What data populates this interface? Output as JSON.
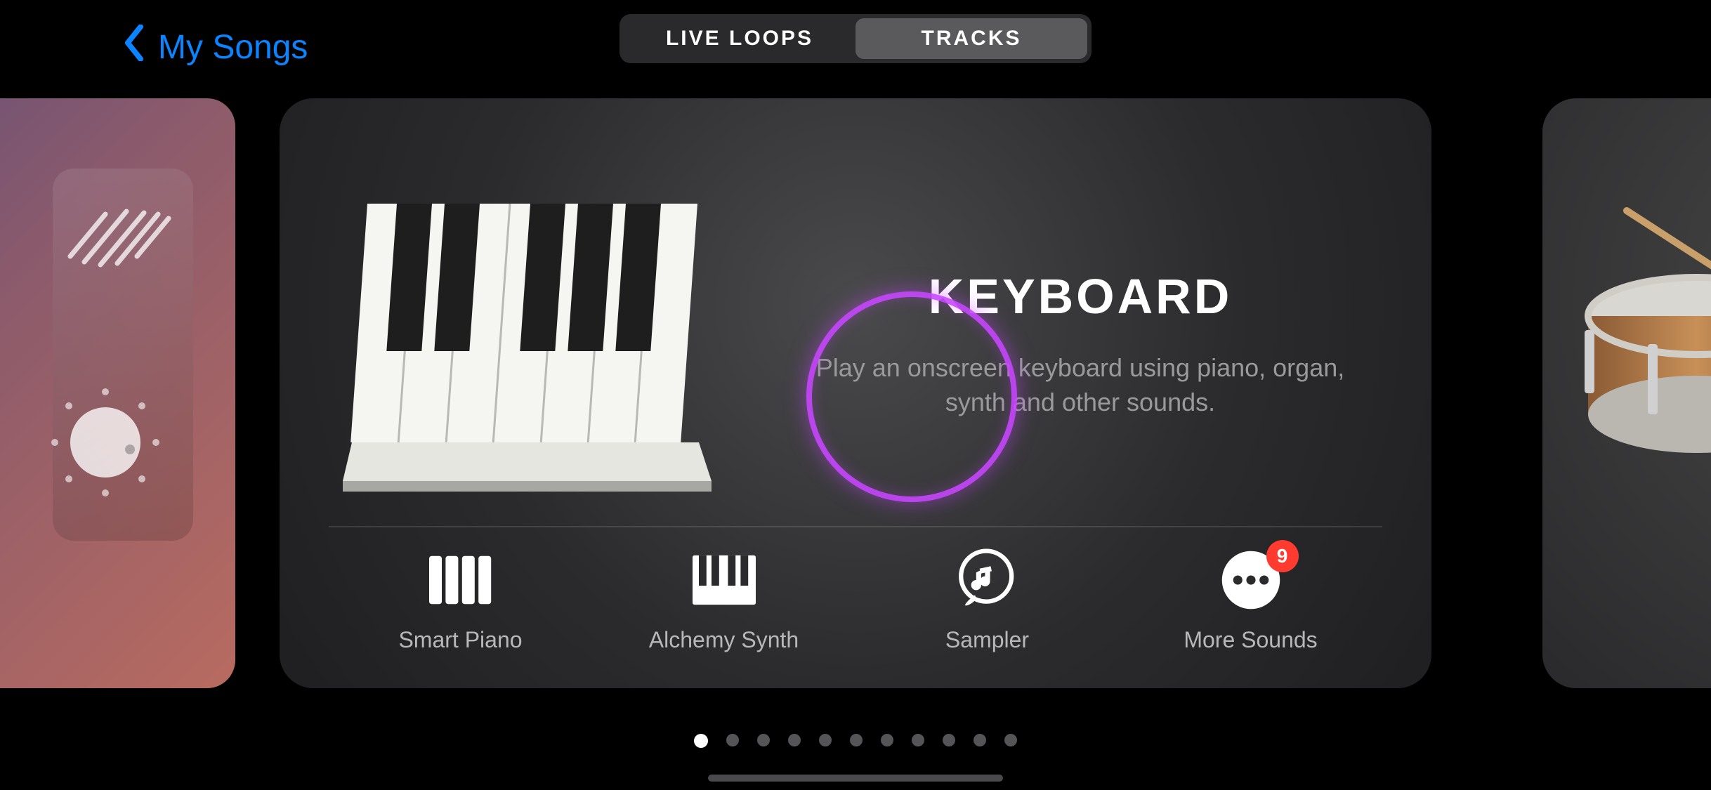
{
  "nav": {
    "back_label": "My Songs",
    "segmented": {
      "live_loops": "LIVE LOOPS",
      "tracks": "TRACKS",
      "active": "tracks"
    }
  },
  "card": {
    "title": "KEYBOARD",
    "description": "Play an onscreen keyboard using piano, organ, synth and other sounds.",
    "subitems": [
      {
        "label": "Smart Piano"
      },
      {
        "label": "Alchemy Synth"
      },
      {
        "label": "Sampler"
      },
      {
        "label": "More Sounds",
        "badge": "9"
      }
    ]
  },
  "pager": {
    "count": 11,
    "active_index": 0
  }
}
